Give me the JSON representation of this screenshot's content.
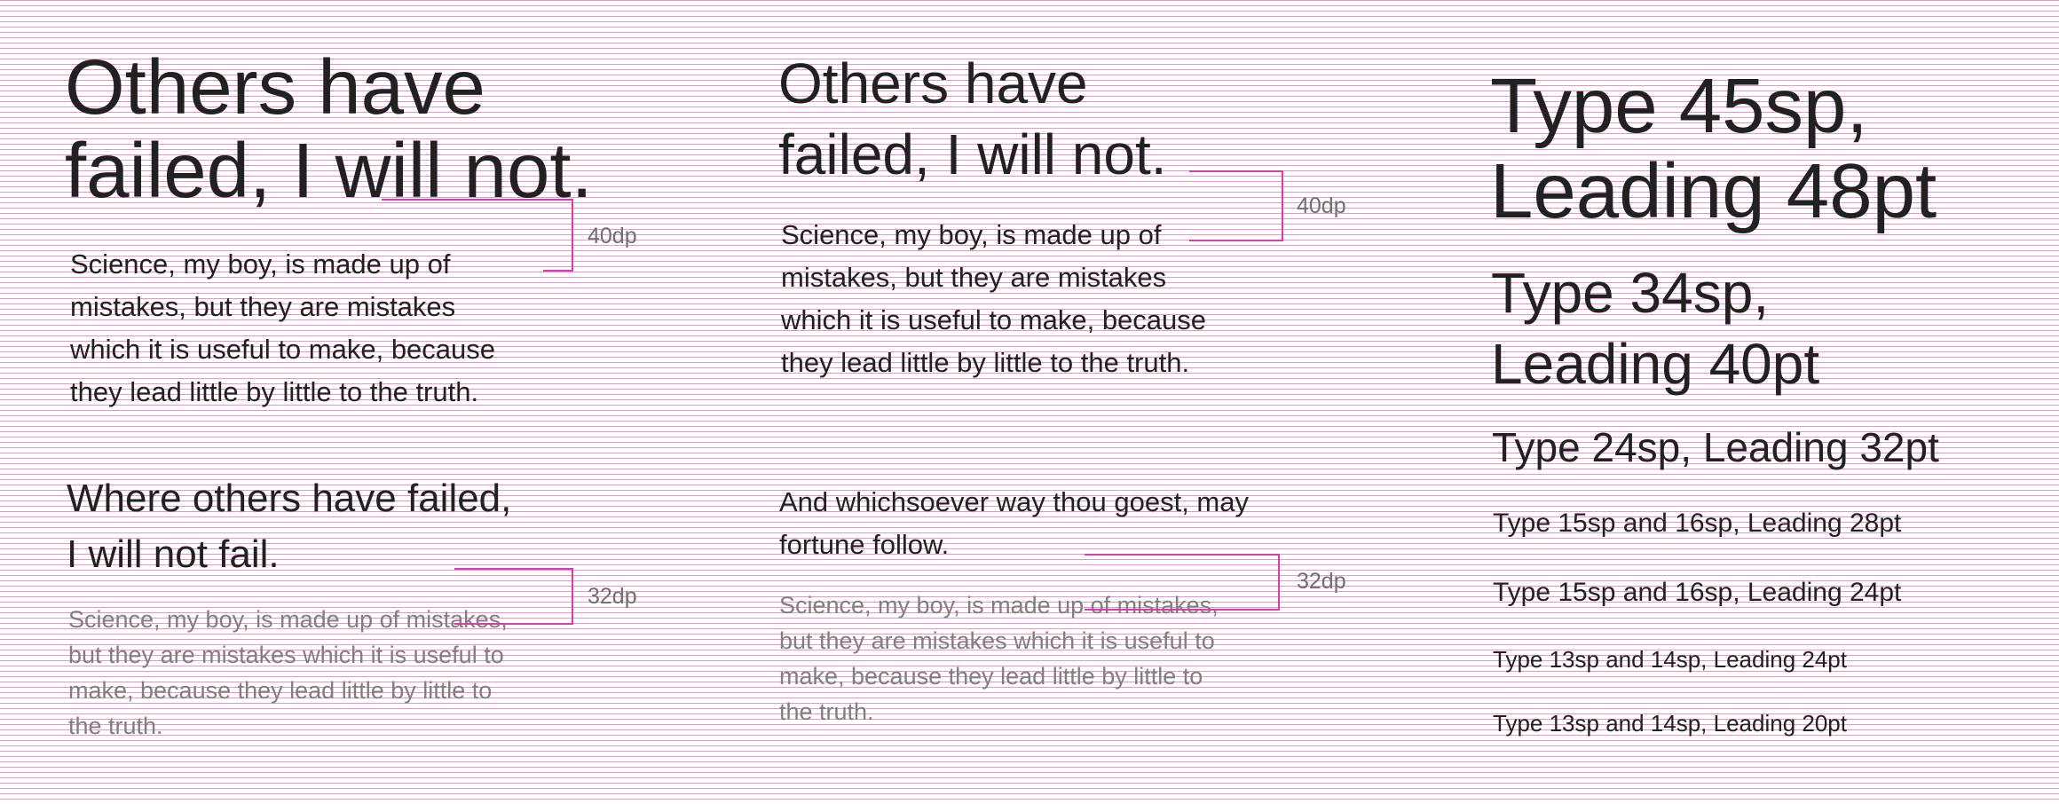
{
  "column_left": {
    "heading_large": "Others have\nfailed, I will not.",
    "body_large": "Science, my boy, is made up of\nmistakes, but they are mistakes\nwhich it is useful to make, because\nthey lead little by little to the truth.",
    "spacing_large": "40dp",
    "heading_small": "Where others have failed,\nI will not fail.",
    "body_small": "Science, my boy, is made up of mistakes,\nbut they are mistakes which it is useful to\nmake, because they lead little by little to\nthe truth.",
    "spacing_small": "32dp"
  },
  "column_middle": {
    "heading_large": "Others have\nfailed, I will not.",
    "body_large": "Science, my boy, is made up of\nmistakes, but they are mistakes\nwhich it is useful to make, because\nthey lead little by little to the truth.",
    "spacing_large": "40dp",
    "heading_small": "And whichsoever way thou goest, may\nfortune follow.",
    "body_small": "Science, my boy, is made up of mistakes,\nbut they are mistakes which it is useful to\nmake, because they lead little by little to\nthe truth.",
    "spacing_small": "32dp"
  },
  "column_right": {
    "samples": [
      "Type 45sp,\nLeading 48pt",
      "Type 34sp,\nLeading 40pt",
      "Type 24sp, Leading 32pt",
      "Type 15sp and 16sp, Leading 28pt",
      "Type 15sp and 16sp, Leading 24pt",
      "Type 13sp and 14sp, Leading 24pt",
      "Type 13sp and 14sp, Leading 20pt"
    ]
  },
  "colors": {
    "baseline_grid": "#d63faa",
    "text_primary": "#212121",
    "text_secondary": "#7f7f7f"
  }
}
